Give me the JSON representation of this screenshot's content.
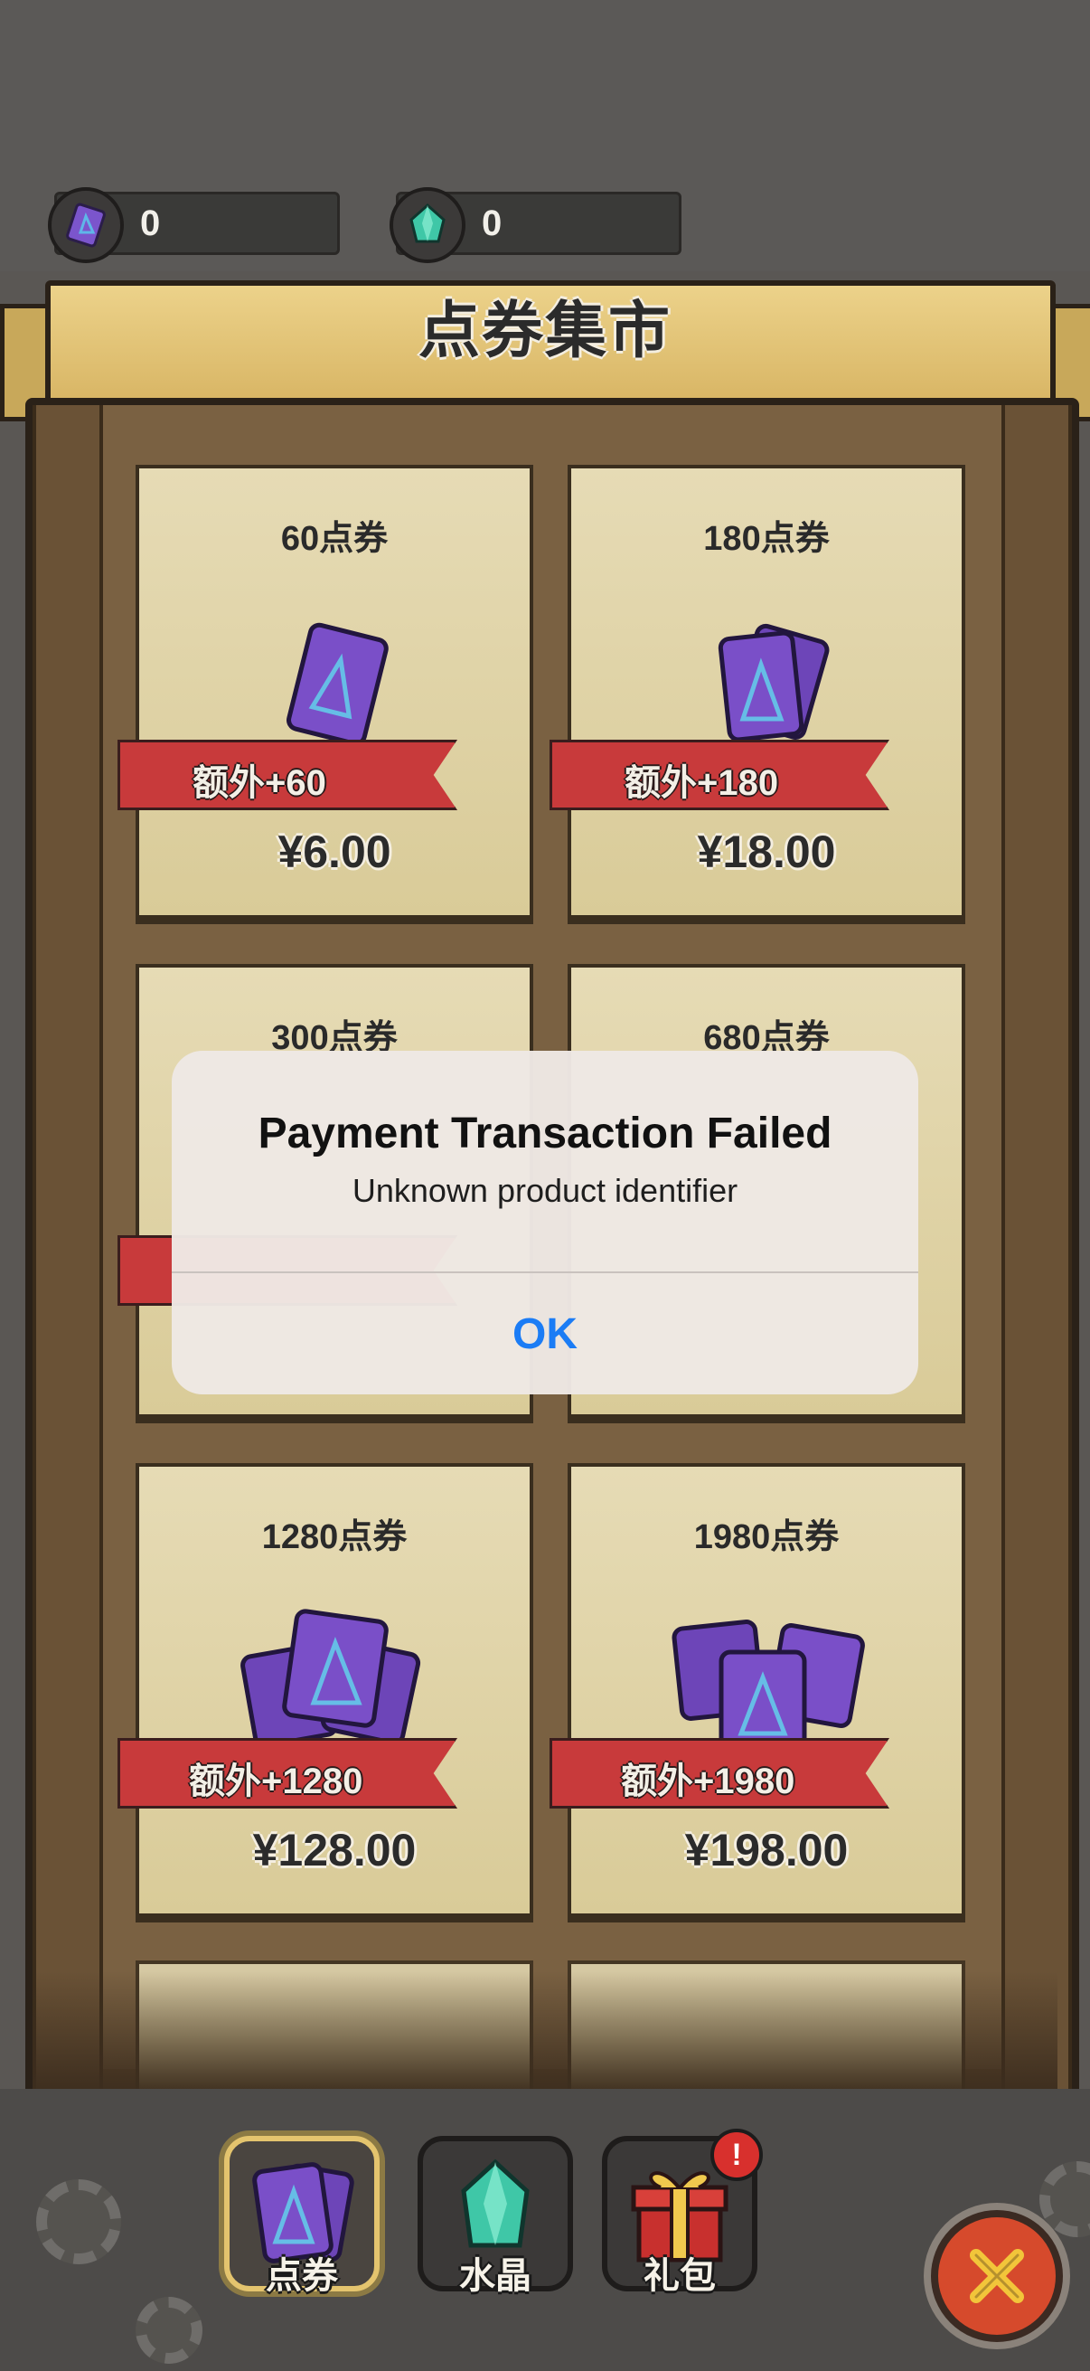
{
  "currencies": [
    {
      "icon": "ticket-card-icon",
      "value": "0"
    },
    {
      "icon": "crystal-icon",
      "value": "0"
    }
  ],
  "banner": {
    "title": "点券集市"
  },
  "products": [
    {
      "name": "60点券",
      "bonus": "额外+60",
      "price": "¥6.00",
      "art": "single-ticket-card-icon"
    },
    {
      "name": "180点券",
      "bonus": "额外+180",
      "price": "¥18.00",
      "art": "ticket-cards-pair-icon"
    },
    {
      "name": "300点券",
      "bonus": "",
      "price": "",
      "art": ""
    },
    {
      "name": "680点券",
      "bonus": "",
      "price": "",
      "art": ""
    },
    {
      "name": "1280点券",
      "bonus": "额外+1280",
      "price": "¥128.00",
      "art": "ticket-card-stack-icon"
    },
    {
      "name": "1980点券",
      "bonus": "额外+1980",
      "price": "¥198.00",
      "art": "ticket-card-pile-icon"
    }
  ],
  "tabs": [
    {
      "label": "点券",
      "icon": "ticket-card-icon",
      "active": true
    },
    {
      "label": "水晶",
      "icon": "crystal-icon",
      "active": false
    },
    {
      "label": "礼包",
      "icon": "gift-box-icon",
      "active": false,
      "badge": "!"
    }
  ],
  "alert": {
    "title": "Payment Transaction Failed",
    "message": "Unknown product identifier",
    "ok_label": "OK"
  },
  "colors": {
    "alert_button": "#1b7cf5",
    "ribbon_red": "#c83a3b",
    "banner_gold": "#e2c67a",
    "card_purple": "#7a4fc8"
  }
}
